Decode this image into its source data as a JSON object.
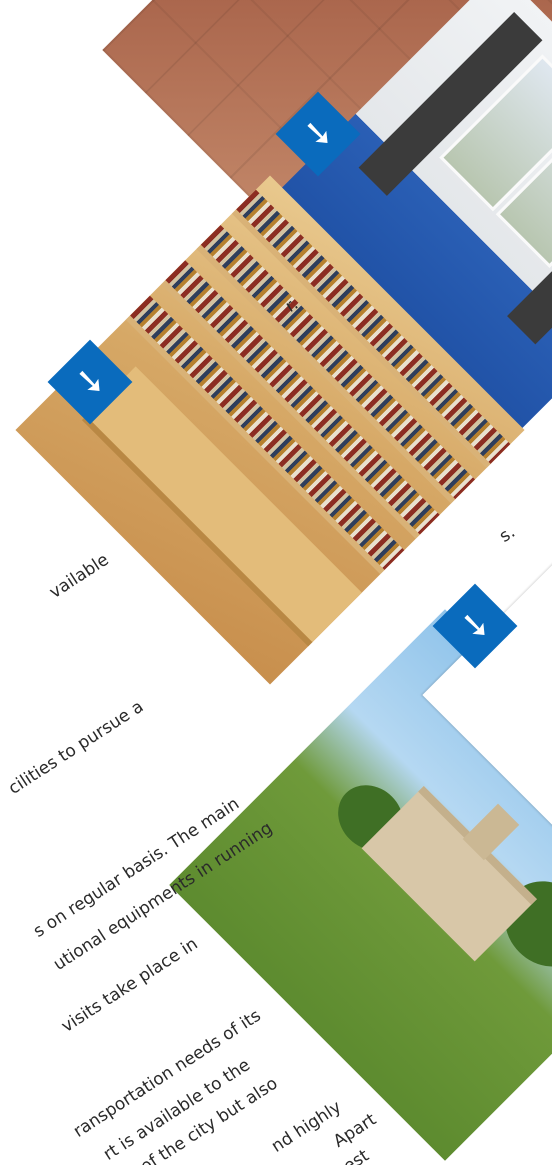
{
  "text_fragments": [
    "r.",
    "s.",
    "vailable",
    "cilities to pursue a",
    "s on regular basis. The main",
    "utional equipments in running",
    "visits take place in",
    "ransportation needs of its",
    "rt  is  available  to  the",
    "s of the city but also",
    "nd highly",
    "Apart",
    "est"
  ],
  "icons": {
    "badge_icon": "arrow-down-left-icon",
    "badge_glyph": "➘",
    "badge_color": "#0a6bbd"
  },
  "tiles": [
    "texture",
    "room",
    "library",
    "campus",
    "white"
  ]
}
